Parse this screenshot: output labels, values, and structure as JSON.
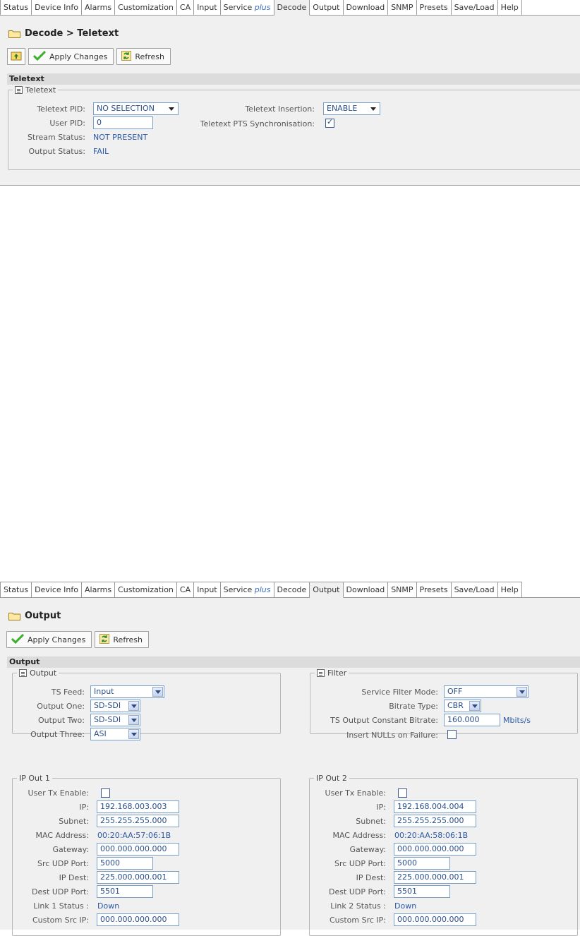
{
  "tabs": [
    {
      "label": "Status"
    },
    {
      "label": "Device Info"
    },
    {
      "label": "Alarms"
    },
    {
      "label": "Customization"
    },
    {
      "label": "CA"
    },
    {
      "label": "Input"
    },
    {
      "label": "Service",
      "suffix": "plus"
    },
    {
      "label": "Decode"
    },
    {
      "label": "Output"
    },
    {
      "label": "Download"
    },
    {
      "label": "SNMP"
    },
    {
      "label": "Presets"
    },
    {
      "label": "Save/Load"
    },
    {
      "label": "Help"
    }
  ],
  "decode": {
    "active_tab": "Decode",
    "breadcrumb": "Decode > Teletext",
    "toolbar": {
      "apply_label": "Apply Changes",
      "refresh_label": "Refresh"
    },
    "section_title": "Teletext",
    "group_title": "Teletext",
    "fields": {
      "teletext_pid_label": "Teletext PID:",
      "teletext_pid_value": "NO SELECTION",
      "user_pid_label": "User PID:",
      "user_pid_value": "0",
      "stream_status_label": "Stream Status:",
      "stream_status_value": "NOT PRESENT",
      "output_status_label": "Output Status:",
      "output_status_value": "FAIL",
      "insertion_label": "Teletext Insertion:",
      "insertion_value": "ENABLE",
      "pts_sync_label": "Teletext PTS Synchronisation:",
      "pts_sync_checked": true
    }
  },
  "output": {
    "active_tab": "Output",
    "breadcrumb": "Output",
    "toolbar": {
      "apply_label": "Apply Changes",
      "refresh_label": "Refresh"
    },
    "section_title": "Output",
    "output_group": {
      "title": "Output",
      "ts_feed_label": "TS Feed:",
      "ts_feed_value": "Input",
      "output_one_label": "Output One:",
      "output_one_value": "SD-SDI",
      "output_two_label": "Output Two:",
      "output_two_value": "SD-SDI",
      "output_three_label": "Output Three:",
      "output_three_value": "ASI"
    },
    "filter_group": {
      "title": "Filter",
      "service_filter_label": "Service Filter Mode:",
      "service_filter_value": "OFF",
      "bitrate_type_label": "Bitrate Type:",
      "bitrate_type_value": "CBR",
      "constant_bitrate_label": "TS Output Constant Bitrate:",
      "constant_bitrate_value": "160.000",
      "bitrate_unit": "Mbits/s",
      "insert_nulls_label": "Insert NULLs on Failure:",
      "insert_nulls_checked": false
    },
    "ip_out_1": {
      "title": "IP Out 1",
      "tx_enable_label": "User Tx Enable:",
      "ip_label": "IP:",
      "ip_value": "192.168.003.003",
      "subnet_label": "Subnet:",
      "subnet_value": "255.255.255.000",
      "mac_label": "MAC Address:",
      "mac_value": "00:20:AA:57:06:1B",
      "gateway_label": "Gateway:",
      "gateway_value": "000.000.000.000",
      "src_udp_label": "Src UDP Port:",
      "src_udp_value": "5000",
      "ip_dest_label": "IP Dest:",
      "ip_dest_value": "225.000.000.001",
      "dest_udp_label": "Dest UDP Port:",
      "dest_udp_value": "5501",
      "link_status_label": "Link 1 Status :",
      "link_status_value": "Down",
      "custom_src_label": "Custom Src IP:",
      "custom_src_value": "000.000.000.000"
    },
    "ip_out_2": {
      "title": "IP Out 2",
      "tx_enable_label": "User Tx Enable:",
      "ip_label": "IP:",
      "ip_value": "192.168.004.004",
      "subnet_label": "Subnet:",
      "subnet_value": "255.255.255.000",
      "mac_label": "MAC Address:",
      "mac_value": "00:20:AA:58:06:1B",
      "gateway_label": "Gateway:",
      "gateway_value": "000.000.000.000",
      "src_udp_label": "Src UDP Port:",
      "src_udp_value": "5000",
      "ip_dest_label": "IP Dest:",
      "ip_dest_value": "225.000.000.001",
      "dest_udp_label": "Dest UDP Port:",
      "dest_udp_value": "5501",
      "link_status_label": "Link 2 Status :",
      "link_status_value": "Down",
      "custom_src_label": "Custom Src IP:",
      "custom_src_value": "000.000.000.000"
    }
  }
}
